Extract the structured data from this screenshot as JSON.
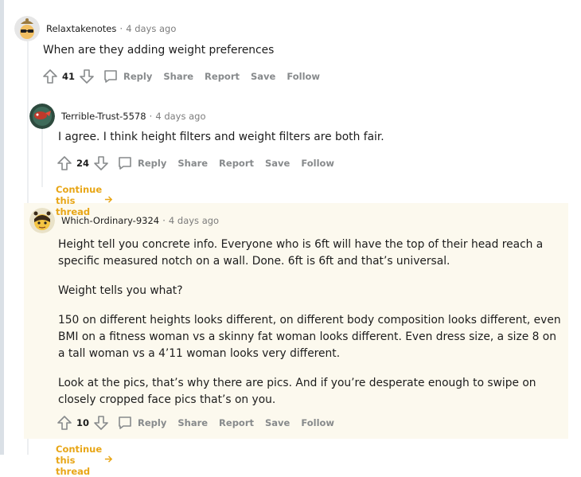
{
  "comments": [
    {
      "author": "Relaxtakenotes",
      "time": "4 days ago",
      "body": [
        "When are they adding weight preferences"
      ],
      "score": "41"
    },
    {
      "author": "Terrible-Trust-5578",
      "time": "4 days ago",
      "body": [
        "I agree. I think height filters and weight filters are both fair."
      ],
      "score": "24",
      "continue_label": "Continue this thread"
    },
    {
      "author": "Which-Ordinary-9324",
      "time": "4 days ago",
      "body": [
        "Height tell you concrete info. Everyone who is 6ft will have the top of their head reach a specific measured notch on a wall. Done. 6ft is 6ft and that’s universal.",
        "Weight tells you what?",
        "150 on different heights looks different, on different body composition looks different, even BMI on a fitness woman vs a skinny fat woman looks different. Even dress size, a size 8 on a tall woman vs a 4’11 woman looks very different.",
        "Look at the pics, that’s why there are pics. And if you’re desperate enough to swipe on closely cropped face pics that’s on you."
      ],
      "score": "10",
      "continue_label": "Continue this thread"
    }
  ],
  "actions": {
    "reply": "Reply",
    "share": "Share",
    "report": "Report",
    "save": "Save",
    "follow": "Follow"
  },
  "separator": "·",
  "colors": {
    "accent": "#e8a617",
    "muted": "#878a8c",
    "highlight": "#fcf9ee"
  }
}
